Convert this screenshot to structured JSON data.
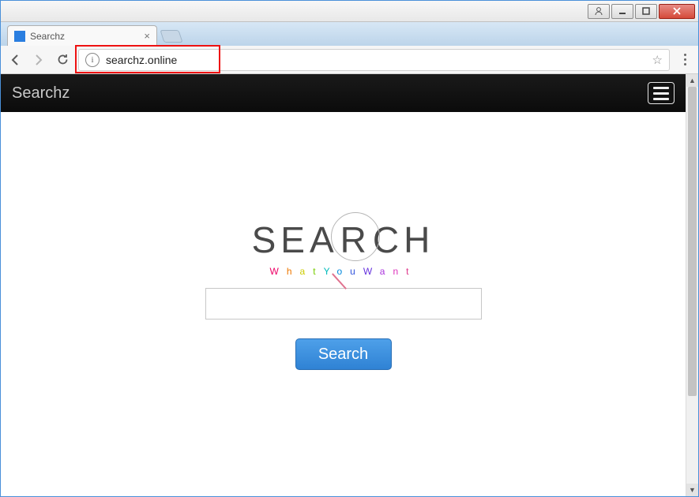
{
  "window": {
    "controls": {
      "user": "",
      "minimize": "",
      "maximize": "",
      "close": ""
    }
  },
  "browser": {
    "tab": {
      "title": "Searchz"
    },
    "nav": {
      "back": "←",
      "forward": "→",
      "reload": "↻"
    },
    "omnibox": {
      "site_info": "i",
      "url": "searchz.online"
    }
  },
  "page": {
    "header": {
      "brand": "Searchz"
    },
    "logo": {
      "pre": "SEA",
      "mag": "R",
      "post": "CH",
      "tagline_chars": [
        "W",
        "h",
        "a",
        "t",
        "Y",
        "o",
        "u",
        "W",
        "a",
        "n",
        "t"
      ]
    },
    "search": {
      "input_value": "",
      "placeholder": "",
      "button_label": "Search"
    }
  }
}
